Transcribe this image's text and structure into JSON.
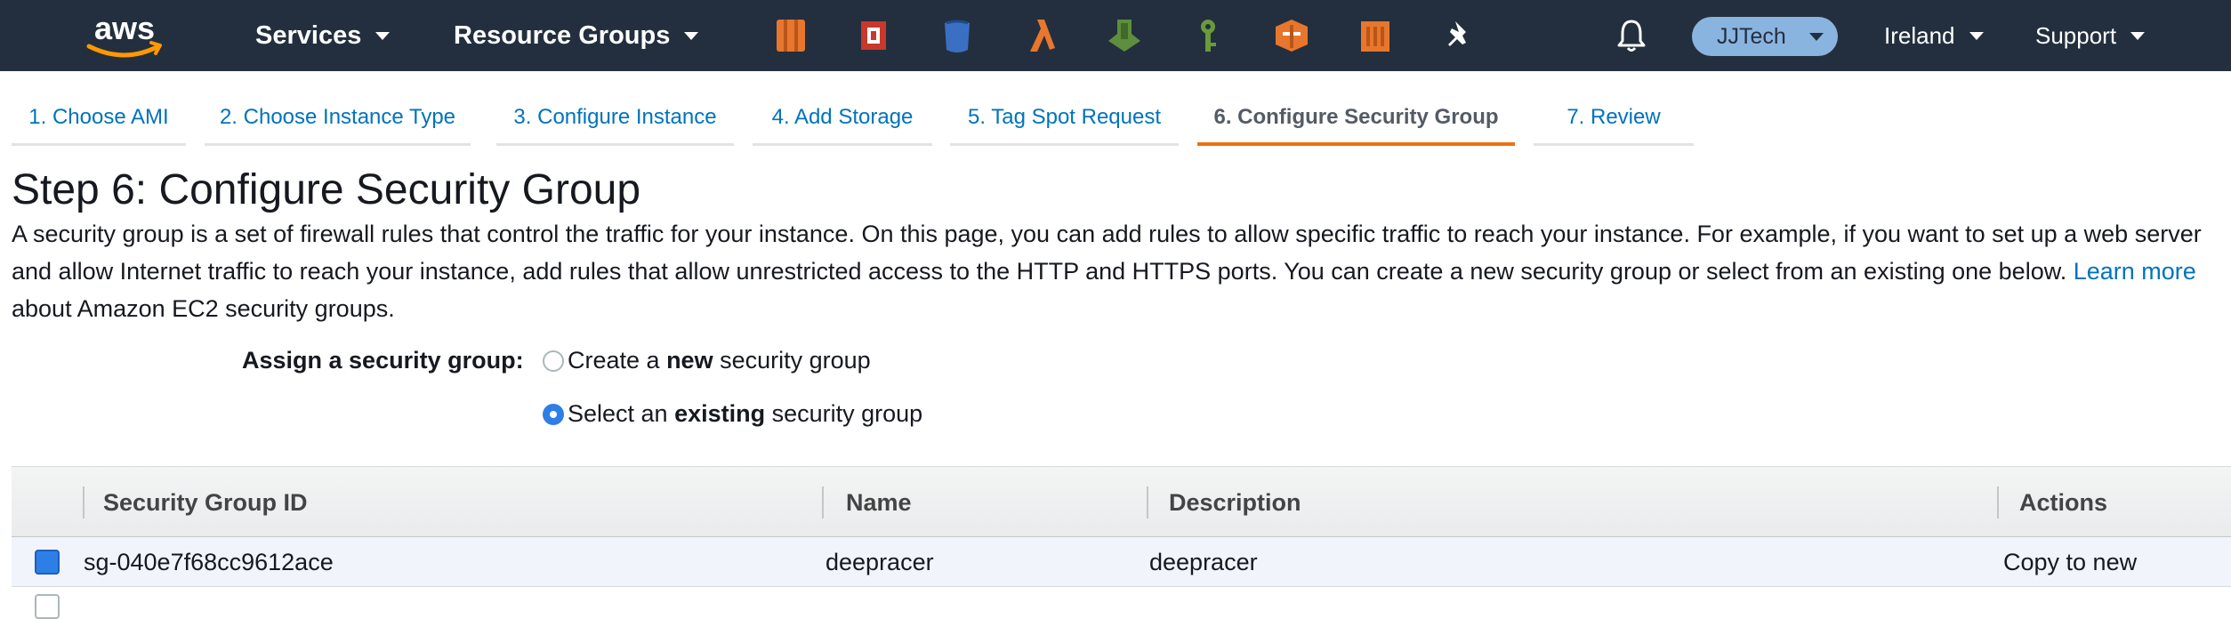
{
  "nav": {
    "logo_alt": "aws",
    "services_label": "Services",
    "resource_groups_label": "Resource Groups",
    "shortcut_icons": [
      "ec2-icon",
      "codedeploy-icon",
      "s3-icon",
      "lambda-icon",
      "sagemaker-icon",
      "iam-icon",
      "cloudformation-icon",
      "deepracer-icon",
      "pin-icon"
    ],
    "user": "JJTech",
    "region": "Ireland",
    "support": "Support"
  },
  "wizard": {
    "tabs": [
      "1. Choose AMI",
      "2. Choose Instance Type",
      "3. Configure Instance",
      "4. Add Storage",
      "5. Tag Spot Request",
      "6. Configure Security Group",
      "7. Review"
    ],
    "active_tab": "6. Configure Security Group"
  },
  "page": {
    "title": "Step 6: Configure Security Group",
    "description": "A security group is a set of firewall rules that control the traffic for your instance. On this page, you can add rules to allow specific traffic to reach your instance. For example, if you want to set up a web server and allow Internet traffic to reach your instance, add rules that allow unrestricted access to the HTTP and HTTPS ports. You can create a new security group or select from an existing one below.",
    "learn_more": "Learn more",
    "learn_more_suffix": "about Amazon EC2 security groups."
  },
  "assign": {
    "label": "Assign a security group:",
    "option_new_pre": "Create a ",
    "option_new_bold": "new",
    "option_new_post": " security group",
    "option_existing_pre": "Select an ",
    "option_existing_bold": "existing",
    "option_existing_post": " security group",
    "selected": "existing"
  },
  "table": {
    "headers": [
      "Security Group ID",
      "Name",
      "Description",
      "Actions"
    ],
    "rows": [
      {
        "selected": true,
        "id": "sg-040e7f68cc9612ace",
        "name": "deepracer",
        "description": "deepracer",
        "action": "Copy to new"
      }
    ]
  },
  "colors": {
    "topbar": "#232f3e",
    "link": "#0073bb",
    "active_tab_underline": "#ec7211",
    "radio_selected": "#2d7fe5",
    "row_selected": "#f1f4fb"
  }
}
